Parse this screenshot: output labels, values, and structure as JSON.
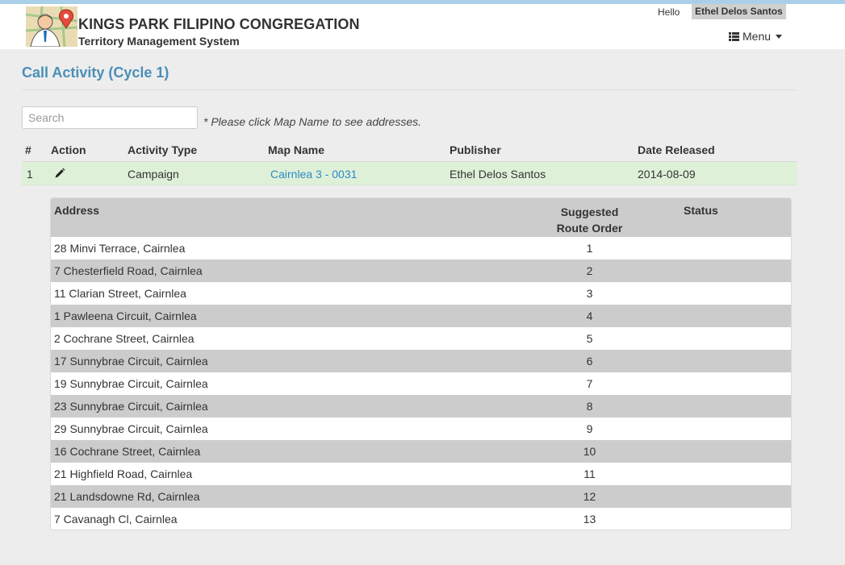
{
  "header": {
    "org_name": "KINGS PARK FILIPINO CONGREGATION",
    "system_name": "Territory Management System",
    "greeting": "Hello",
    "user_name": "Ethel Delos Santos",
    "menu_label": "Menu",
    "logo_icon": "publisher-with-map-pin-logo",
    "top_strip_color": "#a9cfe9"
  },
  "page": {
    "title": "Call Activity (Cycle 1)",
    "title_color": "#4a8fb8"
  },
  "search": {
    "placeholder": "Search",
    "value": "",
    "hint": "* Please click Map Name to see addresses."
  },
  "activity_table": {
    "columns": [
      "#",
      "Action",
      "Activity Type",
      "Map Name",
      "Publisher",
      "Date Released"
    ],
    "rows": [
      {
        "num": "1",
        "action_icon": "pencil-icon",
        "activity_type": "Campaign",
        "map_name": "Cairnlea 3 - 0031",
        "publisher": "Ethel Delos Santos",
        "date_released": "2014-08-09"
      }
    ],
    "selected_row_color": "#dff0d8",
    "link_color": "#2a8bc8"
  },
  "address_table": {
    "col_address": "Address",
    "col_route_line1": "Suggested",
    "col_route_line2": "Route Order",
    "col_status": "Status",
    "rows": [
      {
        "address": "28 Minvi Terrace, Cairnlea",
        "order": "1",
        "status": ""
      },
      {
        "address": "7 Chesterfield Road, Cairnlea",
        "order": "2",
        "status": ""
      },
      {
        "address": "11 Clarian Street, Cairnlea",
        "order": "3",
        "status": ""
      },
      {
        "address": "1 Pawleena Circuit, Cairnlea",
        "order": "4",
        "status": ""
      },
      {
        "address": "2 Cochrane Street, Cairnlea",
        "order": "5",
        "status": ""
      },
      {
        "address": "17 Sunnybrae Circuit, Cairnlea",
        "order": "6",
        "status": ""
      },
      {
        "address": "19 Sunnybrae Circuit, Cairnlea",
        "order": "7",
        "status": ""
      },
      {
        "address": "23 Sunnybrae Circuit, Cairnlea",
        "order": "8",
        "status": ""
      },
      {
        "address": "29 Sunnybrae Circuit, Cairnlea",
        "order": "9",
        "status": ""
      },
      {
        "address": "16 Cochrane Street, Cairnlea",
        "order": "10",
        "status": ""
      },
      {
        "address": "21 Highfield Road, Cairnlea",
        "order": "11",
        "status": ""
      },
      {
        "address": "21 Landsdowne Rd, Cairnlea",
        "order": "12",
        "status": ""
      },
      {
        "address": "7 Cavanagh Cl, Cairnlea",
        "order": "13",
        "status": ""
      }
    ]
  }
}
